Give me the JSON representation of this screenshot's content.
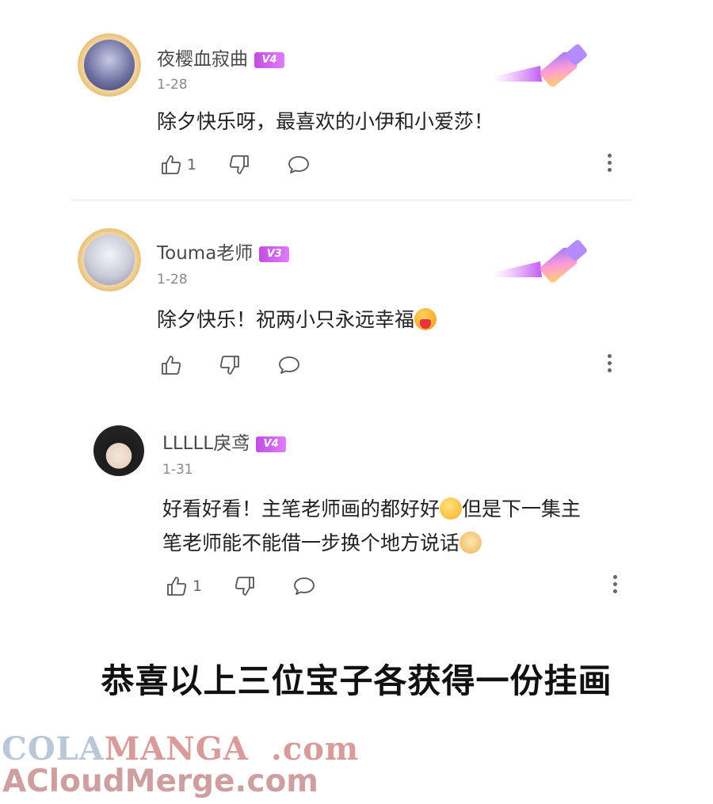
{
  "comments": [
    {
      "username": "夜樱血寂曲",
      "level": "V4",
      "date": "1-28",
      "text": "除夕快乐呀，最喜欢的小伊和小爱莎！",
      "likes": "1"
    },
    {
      "username": "Touma老师",
      "level": "V3",
      "date": "1-28",
      "text": "除夕快乐！祝两小只永远幸福",
      "likes": ""
    },
    {
      "username": "LLLLL戾鸢",
      "level": "V4",
      "date": "1-31",
      "text_line1": "好看好看！主笔老师画的都好好",
      "text_line1b": "但是下一集主",
      "text_line2": "笔老师能不能借一步换个地方说话",
      "likes": "1"
    }
  ],
  "caption": "恭喜以上三位宝子各获得一份挂画",
  "watermark": {
    "line1_a": "COLA",
    "line1_b": "MANGA",
    "line1_c": ".com",
    "line2": "ACloudMerge.com"
  },
  "icons": {
    "like": "thumbs-up-icon",
    "dislike": "thumbs-down-icon",
    "reply": "comment-bubble-icon",
    "more": "more-vertical-icon",
    "decoration": "paint-brush-icon"
  },
  "colors": {
    "badge": "#c04ee0",
    "text": "#222222",
    "meta": "#8a8a8a"
  }
}
